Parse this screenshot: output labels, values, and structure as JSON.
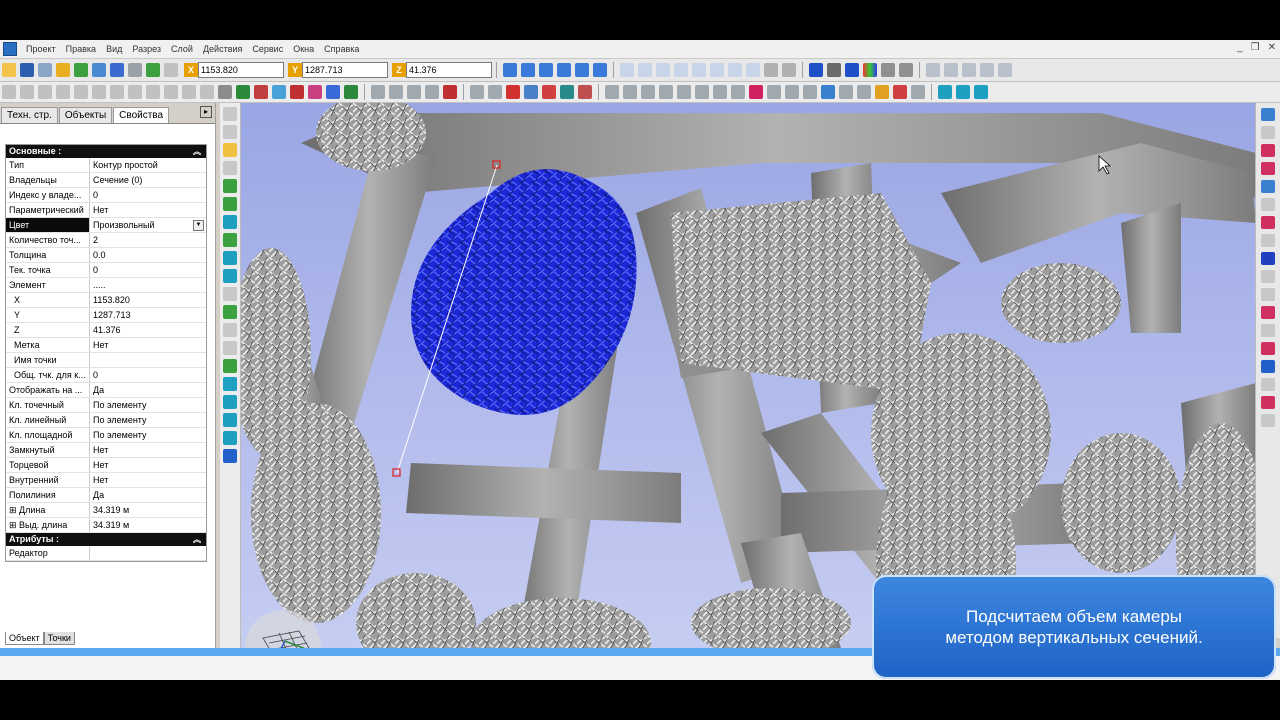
{
  "menu": {
    "items": [
      "Проект",
      "Правка",
      "Вид",
      "Разрез",
      "Слой",
      "Действия",
      "Сервис",
      "Окна",
      "Справка"
    ]
  },
  "coords": {
    "x_label": "X",
    "x": "1153.820",
    "y_label": "Y",
    "y": "1287.713",
    "z_label": "Z",
    "z": "41.376"
  },
  "panel": {
    "tabs": [
      "Техн. стр.",
      "Объекты",
      "Свойства"
    ],
    "section_main": "Основные :",
    "section_attr": "Атрибуты :",
    "rows": [
      {
        "k": "Тип",
        "v": "Контур простой"
      },
      {
        "k": "Владельцы",
        "v": "Сечение (0)"
      },
      {
        "k": "Индекс у владе...",
        "v": "0"
      },
      {
        "k": "Параметрический",
        "v": "Нет"
      },
      {
        "k": "Цвет",
        "v": "Произвольный"
      },
      {
        "k": "Количество точ...",
        "v": "2"
      },
      {
        "k": "Толщина",
        "v": "0.0"
      },
      {
        "k": "Тек. точка",
        "v": "0"
      },
      {
        "k": "Элемент",
        "v": "....."
      },
      {
        "k": "X",
        "v": "1153.820"
      },
      {
        "k": "Y",
        "v": "1287.713"
      },
      {
        "k": "Z",
        "v": "41.376"
      },
      {
        "k": "Метка",
        "v": "Нет"
      },
      {
        "k": "Имя точки",
        "v": ""
      },
      {
        "k": "Общ. тчк. для к...",
        "v": "0"
      },
      {
        "k": "Отображать на ...",
        "v": "Да"
      },
      {
        "k": "Кл. точечный",
        "v": "По элементу"
      },
      {
        "k": "Кл. линейный",
        "v": "По элементу"
      },
      {
        "k": "Кл. площадной",
        "v": "По элементу"
      },
      {
        "k": "Замкнутый",
        "v": "Нет"
      },
      {
        "k": "Торцевой",
        "v": "Нет"
      },
      {
        "k": "Внутренний",
        "v": "Нет"
      },
      {
        "k": "Полилиния",
        "v": "Да"
      },
      {
        "k": "Длина",
        "v": "34.319 м"
      },
      {
        "k": "Выд. длина",
        "v": "34.319 м"
      }
    ],
    "attr_rows": [
      {
        "k": "Редактор",
        "v": ""
      }
    ],
    "bottom_tabs": [
      "Объект",
      "Точки"
    ]
  },
  "viewport": {
    "axis_label": "Y"
  },
  "overlay": {
    "line1": "Подсчитаем объем камеры",
    "line2": "методом вертикальных сечений."
  },
  "colors": {
    "selection": "#1c28d8",
    "mesh": "#a8a8a8",
    "background_top": "#a8b4e6",
    "overlay": "#2a72d6"
  }
}
